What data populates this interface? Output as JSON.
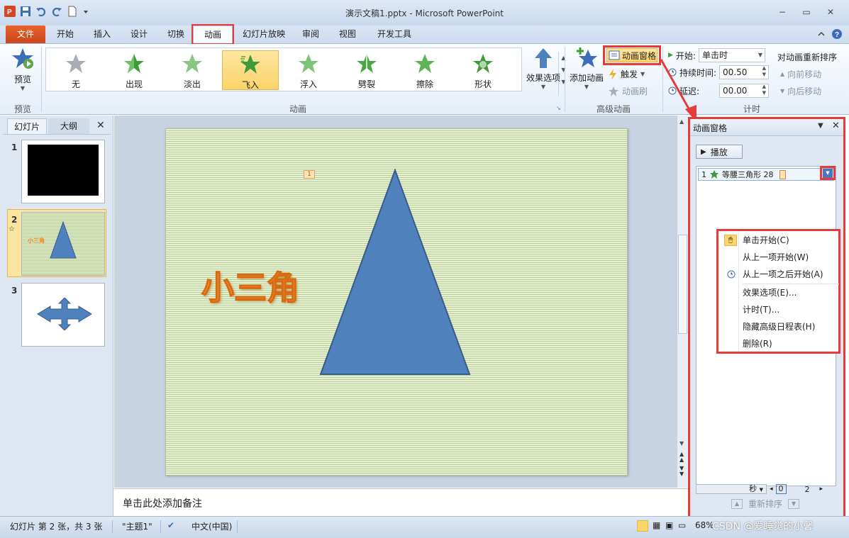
{
  "window": {
    "title": "演示文稿1.pptx - Microsoft PowerPoint",
    "controls": {
      "minimize": "−",
      "restore": "▭",
      "close": "✕"
    }
  },
  "tabs": [
    "文件",
    "开始",
    "插入",
    "设计",
    "切换",
    "动画",
    "幻灯片放映",
    "审阅",
    "视图",
    "开发工具"
  ],
  "active_tab": "动画",
  "ribbon": {
    "preview": {
      "label": "预览",
      "group": "预览"
    },
    "animation_gallery": {
      "group": "动画",
      "items": [
        "无",
        "出现",
        "淡出",
        "飞入",
        "浮入",
        "劈裂",
        "擦除",
        "形状"
      ],
      "selected": "飞入"
    },
    "effect_options": "效果选项",
    "advanced": {
      "group": "高级动画",
      "add_animation": "添加动画",
      "animation_pane": "动画窗格",
      "trigger": "触发",
      "painter": "动画刷"
    },
    "timing": {
      "group": "计时",
      "start_label": "开始:",
      "start_value": "单击时",
      "duration_label": "持续时间:",
      "duration_value": "00.50",
      "delay_label": "延迟:",
      "delay_value": "00.00",
      "reorder_title": "对动画重新排序",
      "move_earlier": "向前移动",
      "move_later": "向后移动"
    }
  },
  "left_pane": {
    "tabs": [
      "幻灯片",
      "大纲"
    ],
    "slides": [
      {
        "num": "1"
      },
      {
        "num": "2",
        "thumb_text": "小三角"
      },
      {
        "num": "3"
      }
    ]
  },
  "slide": {
    "title": "小三角",
    "anim_tag": "1"
  },
  "notes_placeholder": "单击此处添加备注",
  "anim_pane": {
    "title": "动画窗格",
    "play": "播放",
    "item": {
      "index": "1",
      "name": "等腰三角形 28"
    },
    "menu": [
      {
        "text": "单击开始(C)",
        "icon": "mouse-icon"
      },
      {
        "text": "从上一项开始(W)",
        "icon": ""
      },
      {
        "text": "从上一项之后开始(A)",
        "icon": "clock-icon"
      },
      {
        "text": "效果选项(E)...",
        "icon": ""
      },
      {
        "text": "计时(T)...",
        "icon": ""
      },
      {
        "text": "隐藏高级日程表(H)",
        "icon": ""
      },
      {
        "text": "删除(R)",
        "icon": ""
      }
    ],
    "time_unit": "秒",
    "time_start": "0",
    "time_end": "2",
    "reorder": "重新排序"
  },
  "status": {
    "slide_info": "幻灯片 第 2 张，共 3 张",
    "theme": "\"主题1\"",
    "language": "中文(中国)",
    "zoom": "68%"
  },
  "watermark": "CSDN @爱睡觉的小馨",
  "colors": {
    "accent_red": "#e53b3b",
    "file_tab": "#d9532a",
    "triangle": "#4f81bd",
    "title_orange": "#f08a1c",
    "selected_gallery": "#fbd46a"
  }
}
